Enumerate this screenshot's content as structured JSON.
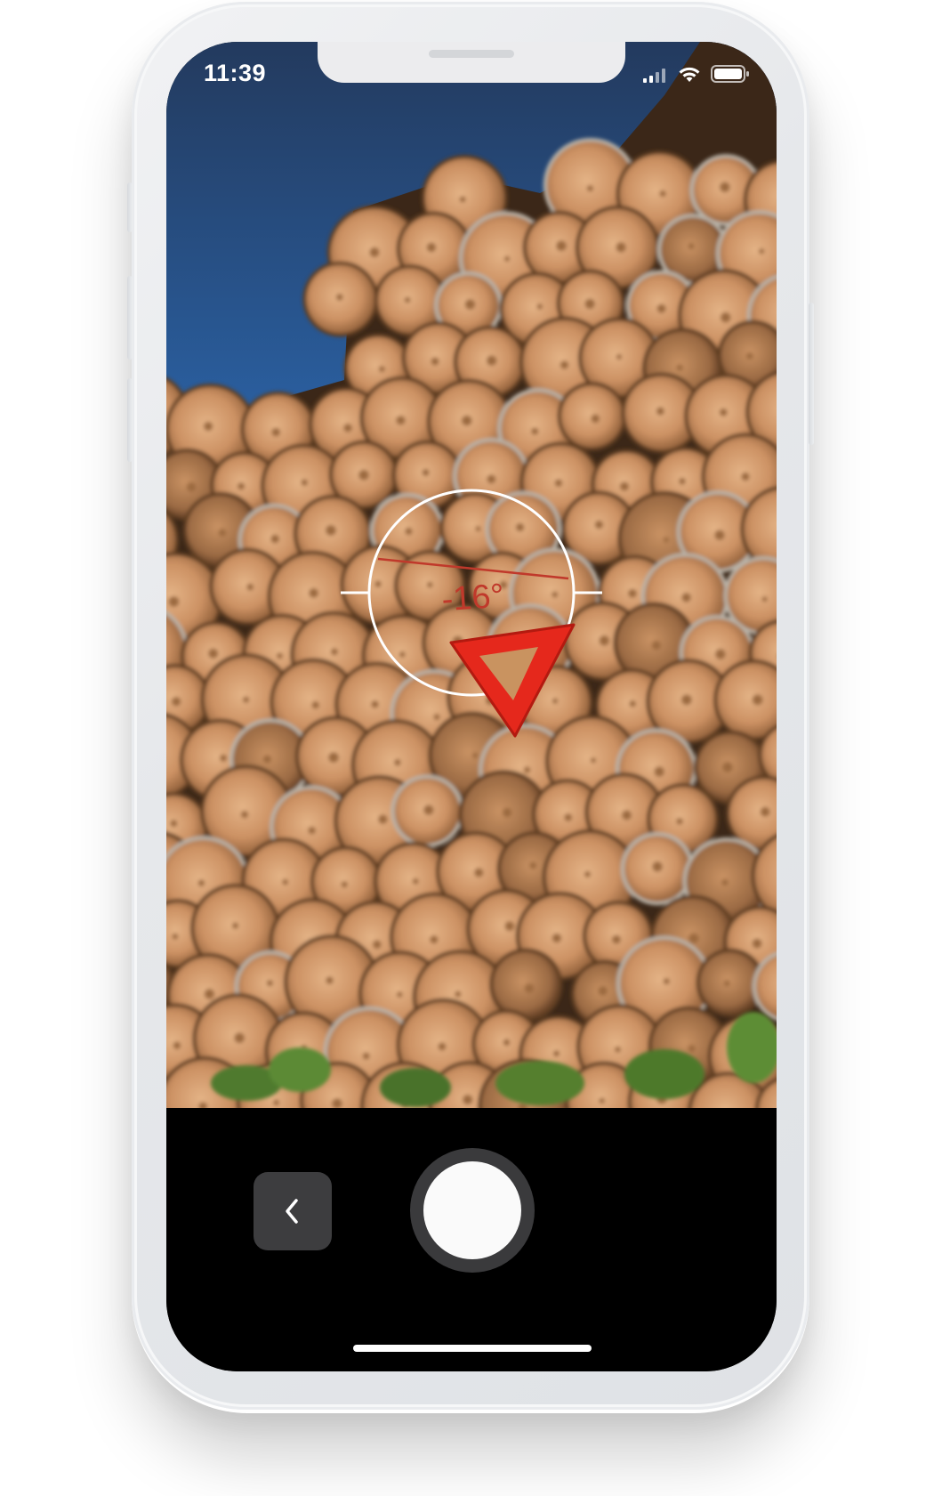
{
  "status_bar": {
    "time": "11:39",
    "signal_icon": "cellular-signal-icon",
    "wifi_icon": "wifi-icon",
    "battery_icon": "battery-icon"
  },
  "level_indicator": {
    "angle_text": "-16°",
    "accent_color": "#c0392b",
    "reticle_color": "#ffffff"
  },
  "target_marker": {
    "icon": "warning-triangle-icon",
    "color": "#e5281c"
  },
  "controls": {
    "back_icon": "chevron-left-icon",
    "shutter_icon": "shutter-button"
  }
}
